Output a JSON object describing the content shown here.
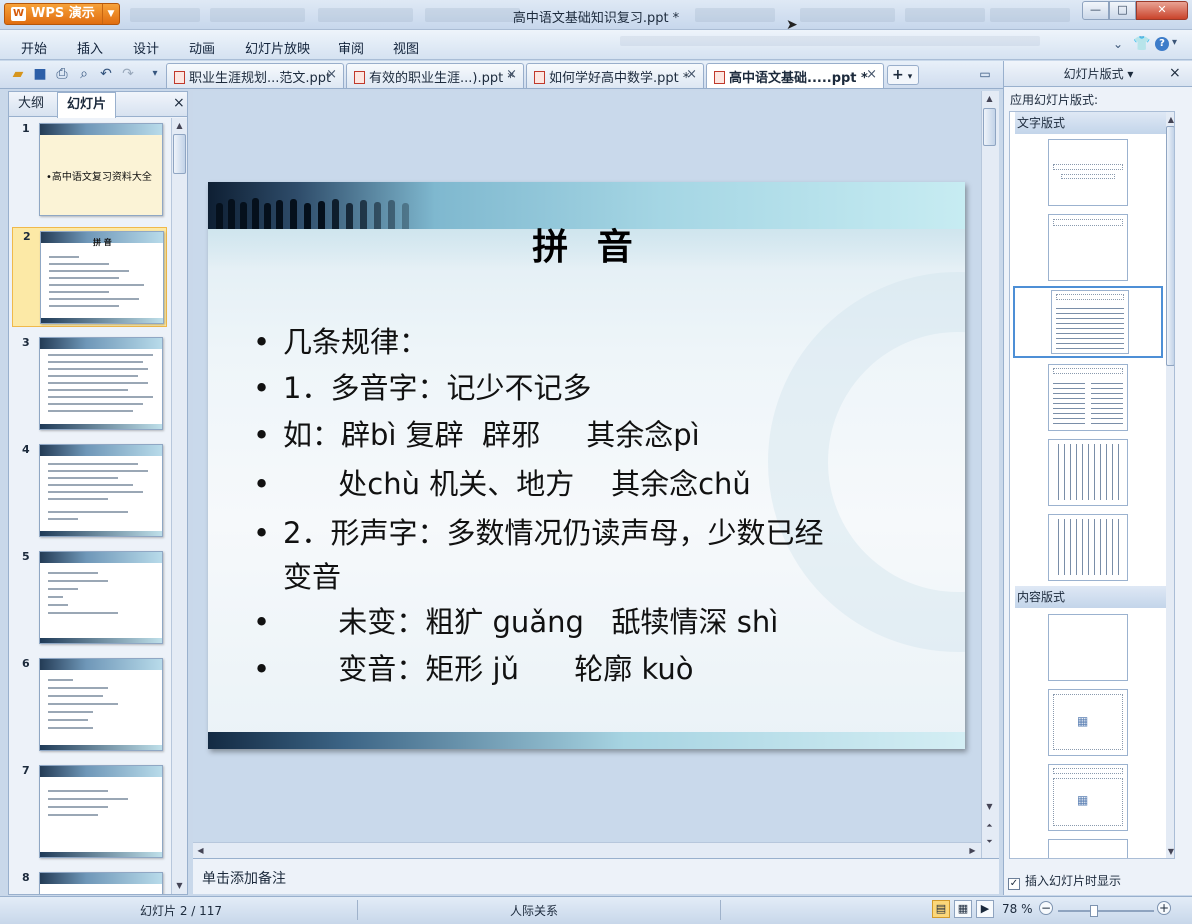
{
  "app": {
    "logo_label": "WPS 演示",
    "logo_icon": "wps-logo-icon"
  },
  "window": {
    "title": "高中语文基础知识复习.ppt *",
    "min_label": "—",
    "max_label": "□",
    "close_label": "✕"
  },
  "menu": [
    "开始",
    "插入",
    "设计",
    "动画",
    "幻灯片放映",
    "审阅",
    "视图"
  ],
  "tabs": [
    {
      "label": "职业生涯规划...范文.ppt",
      "close": "×"
    },
    {
      "label": "有效的职业生涯...).ppt *",
      "close": "×"
    },
    {
      "label": "如何学好高中数学.ppt *",
      "close": "×"
    },
    {
      "label": "高中语文基础.....ppt *",
      "close": "×"
    }
  ],
  "left_pane": {
    "tab_outline": "大纲",
    "tab_slides": "幻灯片",
    "close": "×"
  },
  "thumbnails": [
    {
      "num": "1",
      "text": "•高中语文复习资料大全"
    },
    {
      "num": "2",
      "text": "拼 音"
    },
    {
      "num": "3"
    },
    {
      "num": "4"
    },
    {
      "num": "5"
    },
    {
      "num": "6"
    },
    {
      "num": "7"
    },
    {
      "num": "8"
    }
  ],
  "slide": {
    "title": "拼 音",
    "bullets": [
      {
        "bullet": "•",
        "text": "几条规律："
      },
      {
        "bullet": "•",
        "text": "1．多音字：记少不记多"
      },
      {
        "bullet": "•",
        "text": "如：辟bì 复辟  辟邪     其余念pì"
      },
      {
        "bullet": "•",
        "text": "      处chù 机关、地方    其余念chǔ"
      },
      {
        "bullet": "•",
        "text": "2．形声字：多数情况仍读声母，少数已经"
      },
      {
        "bullet": "",
        "text": "变音"
      },
      {
        "bullet": "•",
        "text": "      未变：粗犷 guǎng   舐犊情深 shì"
      },
      {
        "bullet": "•",
        "text": "      变音：矩形 jǔ      轮廓 kuò"
      }
    ]
  },
  "notes": {
    "placeholder": "单击添加备注"
  },
  "right_pane": {
    "title": "幻灯片版式 ▾",
    "close": "×",
    "apply_label": "应用幻灯片版式:",
    "section_text": "文字版式",
    "section_content": "内容版式",
    "checkbox_label": "插入幻灯片时显示",
    "checkbox_checked": "✓"
  },
  "status": {
    "slide_pos": "幻灯片 2 / 117",
    "theme": "人际关系",
    "zoom": "78 %",
    "zoom_minus": "−",
    "zoom_plus": "+"
  },
  "colors": {
    "accent": "#4d8fd6",
    "selected_thumb": "#fce9a6",
    "logo_orange": "#e06d10"
  }
}
